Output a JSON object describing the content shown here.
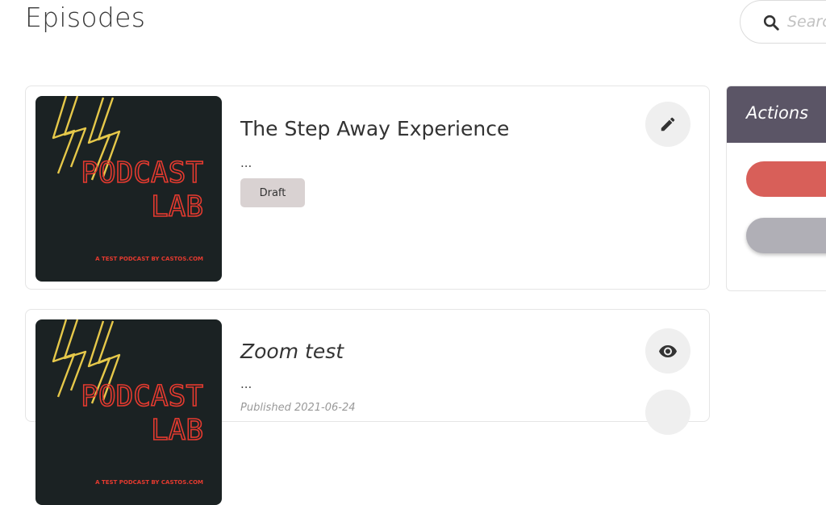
{
  "header": {
    "title": "Episodes"
  },
  "search": {
    "placeholder": "Search"
  },
  "episodes": [
    {
      "title": "The Step Away Experience",
      "description": "...",
      "status": "Draft",
      "cover": {
        "line1": "PODCAST",
        "line2": "LAB",
        "tagline": "A TEST PODCAST BY CASTOS.COM"
      },
      "actions": [
        "pencil-icon"
      ]
    },
    {
      "title": "Zoom test",
      "description": "...",
      "published": "Published 2021-06-24",
      "cover": {
        "line1": "PODCAST",
        "line2": "LAB",
        "tagline": "A TEST PODCAST BY CASTOS.COM"
      },
      "actions": [
        "eye-icon"
      ]
    }
  ],
  "sidebar": {
    "actions_title": "Actions",
    "buttons": [
      {
        "label": "",
        "color": "#d85f59"
      },
      {
        "label": "",
        "color": "#b0afb6"
      }
    ]
  },
  "colors": {
    "actions_header": "#5b5566",
    "cover_background": "#1b2223",
    "neon_red": "#e53a2f",
    "neon_yellow": "#e6c84a",
    "draft_badge": "#d9d2d2"
  }
}
